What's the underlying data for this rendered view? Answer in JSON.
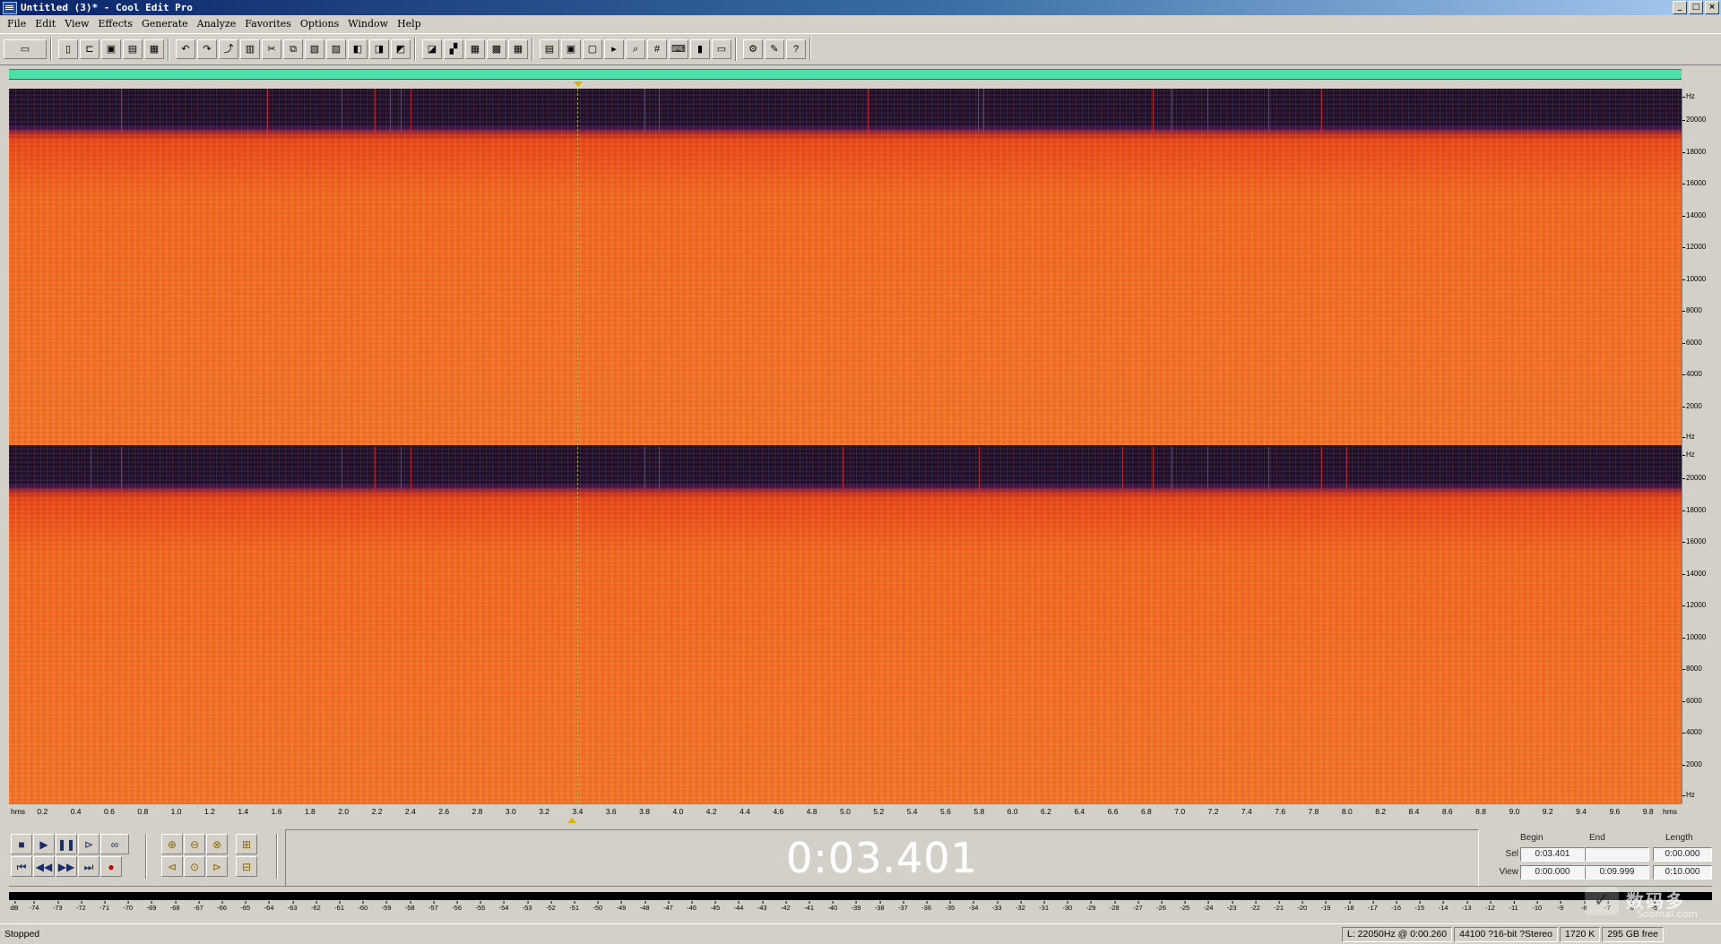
{
  "window": {
    "title": "Untitled (3)* - Cool Edit Pro",
    "controls": [
      "_",
      "□",
      "×"
    ]
  },
  "menu": [
    "File",
    "Edit",
    "View",
    "Effects",
    "Generate",
    "Analyze",
    "Favorites",
    "Options",
    "Window",
    "Help"
  ],
  "toolbar_icons": [
    [
      "waveform-toggle-icon"
    ],
    [
      "new-file-icon",
      "open-file-icon",
      "save-icon",
      "save-as-icon",
      "close-icon"
    ],
    [
      "undo-icon",
      "redo-icon",
      "repeat-icon",
      "copy-new-icon",
      "cut-icon",
      "copy-icon",
      "paste-icon",
      "mix-paste-icon",
      "trim-icon",
      "silence-icon",
      "envelope-icon"
    ],
    [
      "spectral-view-icon",
      "waveform-view-icon",
      "grid-icon",
      "grid-2-icon",
      "grid-3-icon"
    ],
    [
      "frequency-analysis-icon",
      "scan-icon",
      "info-icon",
      "play-icon",
      "zoom-icon",
      "counter-icon",
      "keyboard-icon",
      "meter-icon",
      "layout-icon"
    ],
    [
      "settings-icon",
      "edit-icon",
      "help-icon"
    ]
  ],
  "freq_axis": {
    "unit": "Hz",
    "labels": [
      "20000",
      "18000",
      "16000",
      "14000",
      "12000",
      "10000",
      "8000",
      "6000",
      "4000",
      "2000"
    ]
  },
  "time_axis": {
    "start_label": "hms",
    "end_label": "hms",
    "labels": [
      "0.2",
      "0.4",
      "0.6",
      "0.8",
      "1.0",
      "1.2",
      "1.4",
      "1.6",
      "1.8",
      "2.0",
      "2.2",
      "2.4",
      "2.6",
      "2.8",
      "3.0",
      "3.2",
      "3.4",
      "3.6",
      "3.8",
      "4.0",
      "4.2",
      "4.4",
      "4.6",
      "4.8",
      "5.0",
      "5.2",
      "5.4",
      "5.6",
      "5.8",
      "6.0",
      "6.2",
      "6.4",
      "6.6",
      "6.8",
      "7.0",
      "7.2",
      "7.4",
      "7.6",
      "7.8",
      "8.0",
      "8.2",
      "8.4",
      "8.6",
      "8.8",
      "9.0",
      "9.2",
      "9.4",
      "9.6",
      "9.8"
    ]
  },
  "time_display": "0:03.401",
  "selection": {
    "headers": {
      "begin": "Begin",
      "end": "End",
      "length": "Length"
    },
    "sel": {
      "label": "Sel",
      "begin": "0:03.401",
      "end": "",
      "length": "0:00.000"
    },
    "view": {
      "label": "View",
      "begin": "0:00.000",
      "end": "0:09.999",
      "length": "0:10.000"
    }
  },
  "meter": {
    "start_label": "dB",
    "labels": [
      "-74",
      "-73",
      "-72",
      "-71",
      "-70",
      "-69",
      "-68",
      "-67",
      "-66",
      "-65",
      "-64",
      "-63",
      "-62",
      "-61",
      "-60",
      "-59",
      "-58",
      "-57",
      "-56",
      "-55",
      "-54",
      "-53",
      "-52",
      "-51",
      "-50",
      "-49",
      "-48",
      "-47",
      "-46",
      "-45",
      "-44",
      "-43",
      "-42",
      "-41",
      "-40",
      "-39",
      "-38",
      "-37",
      "-36",
      "-35",
      "-34",
      "-33",
      "-32",
      "-31",
      "-30",
      "-29",
      "-28",
      "-27",
      "-26",
      "-25",
      "-24",
      "-23",
      "-22",
      "-21",
      "-20",
      "-19",
      "-18",
      "-17",
      "-16",
      "-15",
      "-14",
      "-13",
      "-12",
      "-11",
      "-10",
      "-9",
      "-8",
      "-7",
      "-6",
      "-5"
    ]
  },
  "status": {
    "state": "Stopped",
    "cursor": "L: 22050Hz @  0:00.260",
    "format": "44100 ?16-bit ?Stereo",
    "size": "1720 K",
    "free": "295 GB free"
  },
  "watermark": {
    "name": "数码多",
    "domain": "Soomal.com"
  }
}
